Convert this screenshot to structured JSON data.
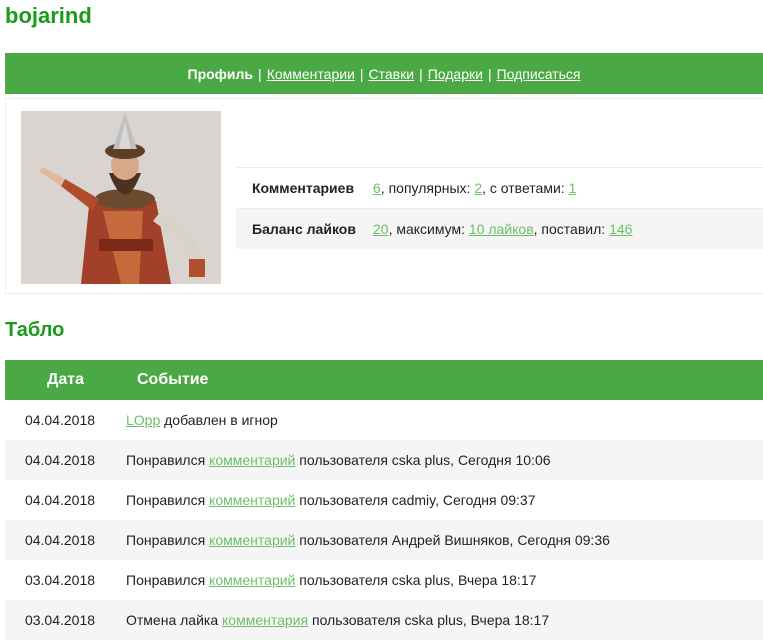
{
  "user": {
    "name": "bojarind"
  },
  "nav": {
    "current": "Профиль",
    "links": [
      "Комментарии",
      "Ставки",
      "Подарки",
      "Подписаться"
    ],
    "separator": "|"
  },
  "stats": {
    "comments": {
      "label": "Комментариев",
      "total": "6",
      "popular_prefix": ", популярных: ",
      "popular": "2",
      "replies_prefix": ", с ответами: ",
      "replies": "1"
    },
    "likes": {
      "label": "Баланс лайков",
      "balance": "20",
      "max_prefix": ", максимум: ",
      "max": "10 лайков",
      "given_prefix": ", поставил: ",
      "given": "146"
    }
  },
  "board": {
    "title": "Табло",
    "columns": [
      "Дата",
      "Событие"
    ],
    "rows": [
      {
        "date": "04.04.2018",
        "pre": "",
        "link": "LOpp",
        "post": " добавлен в игнор"
      },
      {
        "date": "04.04.2018",
        "pre": "Понравился ",
        "link": "комментарий",
        "post": " пользователя cska plus, Сегодня 10:06"
      },
      {
        "date": "04.04.2018",
        "pre": "Понравился ",
        "link": "комментарий",
        "post": " пользователя cadmiy, Сегодня 09:37"
      },
      {
        "date": "04.04.2018",
        "pre": "Понравился ",
        "link": "комментарий",
        "post": " пользователя Андрей Вишняков, Сегодня 09:36"
      },
      {
        "date": "03.04.2018",
        "pre": "Понравился ",
        "link": "комментарий",
        "post": " пользователя cska plus, Вчера 18:17"
      },
      {
        "date": "03.04.2018",
        "pre": "Отмена лайка ",
        "link": "комментария",
        "post": " пользователя cska plus, Вчера 18:17"
      }
    ]
  },
  "colors": {
    "brand_green": "#1c9a1c",
    "bar_green": "#4aa945",
    "link_green": "#6cbf69"
  }
}
